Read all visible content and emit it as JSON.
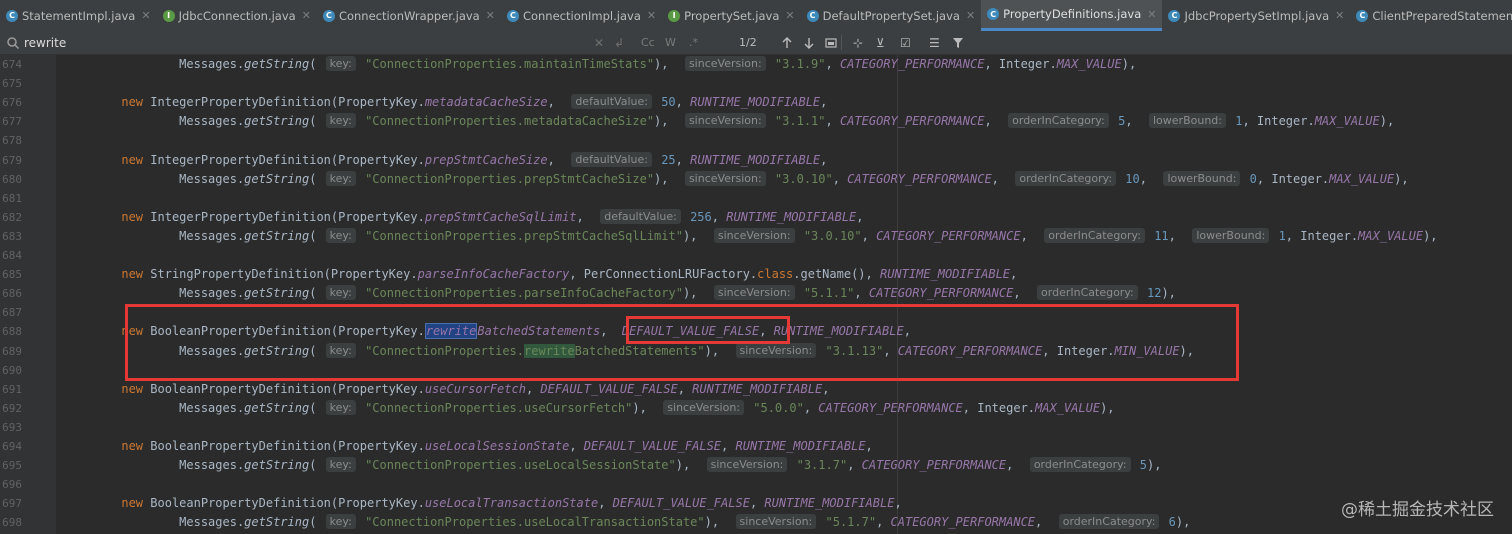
{
  "tabs": [
    {
      "label": "StatementImpl.java",
      "icon": "class-icon",
      "active": false
    },
    {
      "label": "JdbcConnection.java",
      "icon": "interface-icon",
      "active": false
    },
    {
      "label": "ConnectionWrapper.java",
      "icon": "class-icon",
      "active": false
    },
    {
      "label": "ConnectionImpl.java",
      "icon": "class-icon",
      "active": false
    },
    {
      "label": "PropertySet.java",
      "icon": "interface-icon",
      "active": false
    },
    {
      "label": "DefaultPropertySet.java",
      "icon": "class-icon",
      "active": false
    },
    {
      "label": "PropertyDefinitions.java",
      "icon": "class-icon",
      "active": true
    },
    {
      "label": "JdbcPropertySetImpl.java",
      "icon": "class-icon",
      "active": false
    },
    {
      "label": "ClientPreparedStatement.java",
      "icon": "class-icon",
      "active": false
    }
  ],
  "search": {
    "value": "rewrite",
    "match_count": "1/2",
    "cc": "Cc",
    "w": "W",
    "regex": ".*"
  },
  "lines": [
    {
      "n": "674",
      "html": "              Messages.<span class=\"mtd\">getString</span>( <span class=\"hint\">key:</span> <span class=\"str\">\"ConnectionProperties.maintainTimeStats\"</span>),  <span class=\"hint\">sinceVersion:</span> <span class=\"str\">\"3.1.9\"</span>, <span class=\"fld\">CATEGORY_PERFORMANCE</span>, Integer.<span class=\"fld\">MAX_VALUE</span>),"
    },
    {
      "n": "675",
      "html": ""
    },
    {
      "n": "676",
      "html": "      <span class=\"kw\">new</span> IntegerPropertyDefinition(PropertyKey.<span class=\"fld\">metadataCacheSize</span>,  <span class=\"hint\">defaultValue:</span> <span class=\"num\">50</span>, <span class=\"fld\">RUNTIME_MODIFIABLE</span>,"
    },
    {
      "n": "677",
      "html": "              Messages.<span class=\"mtd\">getString</span>( <span class=\"hint\">key:</span> <span class=\"str\">\"ConnectionProperties.metadataCacheSize\"</span>),  <span class=\"hint\">sinceVersion:</span> <span class=\"str\">\"3.1.1\"</span>, <span class=\"fld\">CATEGORY_PERFORMANCE</span>,  <span class=\"hint\">orderInCategory:</span> <span class=\"num\">5</span>,  <span class=\"hint\">lowerBound:</span> <span class=\"num\">1</span>, Integer.<span class=\"fld\">MAX_VALUE</span>),"
    },
    {
      "n": "678",
      "html": ""
    },
    {
      "n": "679",
      "html": "      <span class=\"kw\">new</span> IntegerPropertyDefinition(PropertyKey.<span class=\"fld\">prepStmtCacheSize</span>,  <span class=\"hint\">defaultValue:</span> <span class=\"num\">25</span>, <span class=\"fld\">RUNTIME_MODIFIABLE</span>,"
    },
    {
      "n": "680",
      "html": "              Messages.<span class=\"mtd\">getString</span>( <span class=\"hint\">key:</span> <span class=\"str\">\"ConnectionProperties.prepStmtCacheSize\"</span>),  <span class=\"hint\">sinceVersion:</span> <span class=\"str\">\"3.0.10\"</span>, <span class=\"fld\">CATEGORY_PERFORMANCE</span>,  <span class=\"hint\">orderInCategory:</span> <span class=\"num\">10</span>,  <span class=\"hint\">lowerBound:</span> <span class=\"num\">0</span>, Integer.<span class=\"fld\">MAX_VALUE</span>),"
    },
    {
      "n": "681",
      "html": ""
    },
    {
      "n": "682",
      "html": "      <span class=\"kw\">new</span> IntegerPropertyDefinition(PropertyKey.<span class=\"fld\">prepStmtCacheSqlLimit</span>,  <span class=\"hint\">defaultValue:</span> <span class=\"num\">256</span>, <span class=\"fld\">RUNTIME_MODIFIABLE</span>,"
    },
    {
      "n": "683",
      "html": "              Messages.<span class=\"mtd\">getString</span>( <span class=\"hint\">key:</span> <span class=\"str\">\"ConnectionProperties.prepStmtCacheSqlLimit\"</span>),  <span class=\"hint\">sinceVersion:</span> <span class=\"str\">\"3.0.10\"</span>, <span class=\"fld\">CATEGORY_PERFORMANCE</span>,  <span class=\"hint\">orderInCategory:</span> <span class=\"num\">11</span>,  <span class=\"hint\">lowerBound:</span> <span class=\"num\">1</span>, Integer.<span class=\"fld\">MAX_VALUE</span>),"
    },
    {
      "n": "684",
      "html": ""
    },
    {
      "n": "685",
      "html": "      <span class=\"kw\">new</span> StringPropertyDefinition(PropertyKey.<span class=\"fld\">parseInfoCacheFactory</span>, PerConnectionLRUFactory.<span class=\"kw\">class</span>.getName(), <span class=\"fld\">RUNTIME_MODIFIABLE</span>,"
    },
    {
      "n": "686",
      "html": "              Messages.<span class=\"mtd\">getString</span>( <span class=\"hint\">key:</span> <span class=\"str\">\"ConnectionProperties.parseInfoCacheFactory\"</span>),  <span class=\"hint\">sinceVersion:</span> <span class=\"str\">\"5.1.1\"</span>, <span class=\"fld\">CATEGORY_PERFORMANCE</span>,  <span class=\"hint\">orderInCategory:</span> <span class=\"num\">12</span>),"
    },
    {
      "n": "687",
      "html": ""
    },
    {
      "n": "688",
      "html": "      <span class=\"kw\">new</span> BooleanPropertyDefinition(PropertyKey.<span class=\"fld\"><span class=\"hl1\">rewrite</span>BatchedStatements</span>,  <span class=\"fld\">DEFAULT_VALUE_FALSE</span>, <span class=\"fld\">RUNTIME_MODIFIABLE</span>,"
    },
    {
      "n": "689",
      "html": "              Messages.<span class=\"mtd\">getString</span>( <span class=\"hint\">key:</span> <span class=\"str\">\"ConnectionProperties.<span class=\"hl2\">rewrite</span>BatchedStatements\"</span>),  <span class=\"hint\">sinceVersion:</span> <span class=\"str\">\"3.1.13\"</span>, <span class=\"fld\">CATEGORY_PERFORMANCE</span>, Integer.<span class=\"fld\">MIN_VALUE</span>),"
    },
    {
      "n": "690",
      "html": ""
    },
    {
      "n": "691",
      "html": "      <span class=\"kw\">new</span> BooleanPropertyDefinition(PropertyKey.<span class=\"fld\">useCursorFetch</span>, <span class=\"fld\">DEFAULT_VALUE_FALSE</span>, <span class=\"fld\">RUNTIME_MODIFIABLE</span>,"
    },
    {
      "n": "692",
      "html": "              Messages.<span class=\"mtd\">getString</span>( <span class=\"hint\">key:</span> <span class=\"str\">\"ConnectionProperties.useCursorFetch\"</span>),  <span class=\"hint\">sinceVersion:</span> <span class=\"str\">\"5.0.0\"</span>, <span class=\"fld\">CATEGORY_PERFORMANCE</span>, Integer.<span class=\"fld\">MAX_VALUE</span>),"
    },
    {
      "n": "693",
      "html": ""
    },
    {
      "n": "694",
      "html": "      <span class=\"kw\">new</span> BooleanPropertyDefinition(PropertyKey.<span class=\"fld\">useLocalSessionState</span>, <span class=\"fld\">DEFAULT_VALUE_FALSE</span>, <span class=\"fld\">RUNTIME_MODIFIABLE</span>,"
    },
    {
      "n": "695",
      "html": "              Messages.<span class=\"mtd\">getString</span>( <span class=\"hint\">key:</span> <span class=\"str\">\"ConnectionProperties.useLocalSessionState\"</span>),  <span class=\"hint\">sinceVersion:</span> <span class=\"str\">\"3.1.7\"</span>, <span class=\"fld\">CATEGORY_PERFORMANCE</span>,  <span class=\"hint\">orderInCategory:</span> <span class=\"num\">5</span>),"
    },
    {
      "n": "696",
      "html": ""
    },
    {
      "n": "697",
      "html": "      <span class=\"kw\">new</span> BooleanPropertyDefinition(PropertyKey.<span class=\"fld\">useLocalTransactionState</span>, <span class=\"fld\">DEFAULT_VALUE_FALSE</span>, <span class=\"fld\">RUNTIME_MODIFIABLE</span>,"
    },
    {
      "n": "698",
      "html": "              Messages.<span class=\"mtd\">getString</span>( <span class=\"hint\">key:</span> <span class=\"str\">\"ConnectionProperties.useLocalTransactionState\"</span>),  <span class=\"hint\">sinceVersion:</span> <span class=\"str\">\"5.1.7\"</span>, <span class=\"fld\">CATEGORY_PERFORMANCE</span>,  <span class=\"hint\">orderInCategory:</span> <span class=\"num\">6</span>),"
    }
  ],
  "watermark": "@稀土掘金技术社区",
  "colors": {
    "editor_bg": "#2b2b2b",
    "keyword": "#cc7832",
    "field": "#9876aa",
    "string": "#6a8759",
    "number": "#6897bb",
    "annotation_box": "#e53935"
  }
}
